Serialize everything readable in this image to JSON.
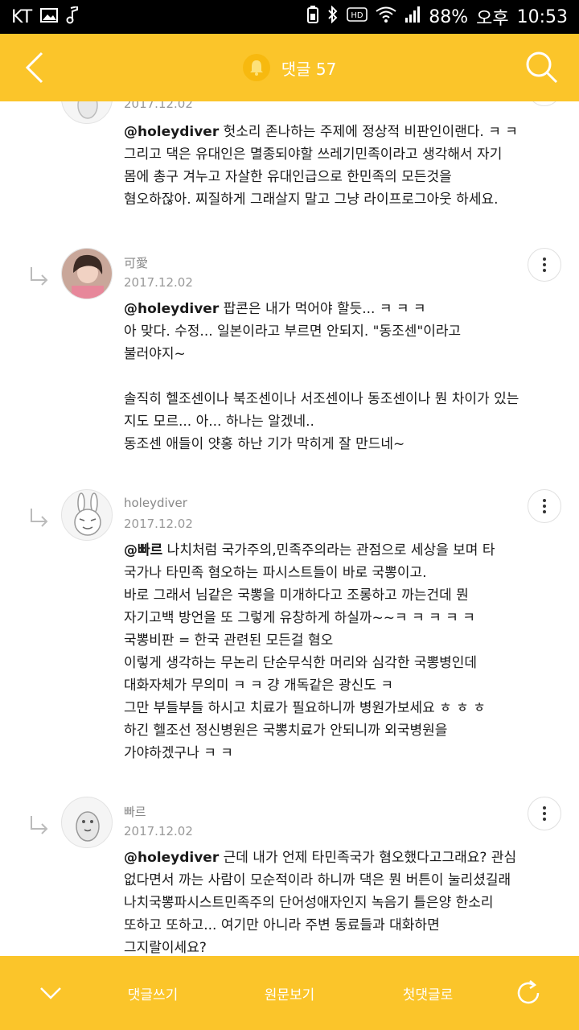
{
  "status_bar": {
    "carrier": "KT",
    "battery": "88%",
    "ampm": "오후",
    "time": "10:53"
  },
  "header": {
    "title": "댓글 57",
    "back_icon": "chevron-left-icon",
    "search_icon": "search-icon",
    "bell_icon": "bell-icon"
  },
  "comments": [
    {
      "date": "2017.12.02",
      "lines": [
        {
          "mention": "@holeydiver",
          "text": " 헛소리 존나하는 주제에 정상적 비판인이랜다. ㅋ ㅋ"
        },
        {
          "text": "그리고 댁은 유대인은 멸종되야할 쓰레기민족이라고 생각해서 자기"
        },
        {
          "text": "몸에 총구 겨누고 자살한 유대인급으로 한민족의 모든것을"
        },
        {
          "text": "혐오하잖아. 찌질하게 그래살지 말고 그냥 라이프로그아웃 하세요."
        }
      ]
    },
    {
      "author": "可愛",
      "date": "2017.12.02",
      "lines": [
        {
          "mention": "@holeydiver",
          "text": " 팝콘은 내가 먹어야 할듯... ㅋ ㅋ ㅋ"
        },
        {
          "text": "아 맞다. 수정... 일본이라고 부르면 안되지. \"동조센\"이라고"
        },
        {
          "text": "불러야지~"
        },
        {
          "text": ""
        },
        {
          "text": "솔직히 헬조센이나 북조센이나 서조센이나 동조센이나 뭔 차이가 있는"
        },
        {
          "text": "지도 모르... 아... 하나는 알겠네.."
        },
        {
          "text": "동조센 애들이 얏홍 하난 기가 막히게 잘 만드네~"
        }
      ]
    },
    {
      "author": "holeydiver",
      "date": "2017.12.02",
      "lines": [
        {
          "mention": "@빠르",
          "text": " 나치처럼 국가주의,민족주의라는 관점으로 세상을 보며 타"
        },
        {
          "text": "국가나 타민족 혐오하는 파시스트들이 바로 국뽕이고."
        },
        {
          "text": "바로 그래서 님같은 국뽕을 미개하다고 조롱하고 까는건데 뭔"
        },
        {
          "text": "자기고백 방언을 또 그렇게 유창하게 하실까~~ㅋ ㅋ ㅋ ㅋ ㅋ"
        },
        {
          "text": "국뽕비판 = 한국 관련된 모든걸 혐오"
        },
        {
          "text": "이렇게 생각하는 무논리 단순무식한 머리와 심각한 국뽕병인데"
        },
        {
          "text": "대화자체가 무의미 ㅋ ㅋ 걍 개독같은 광신도 ㅋ"
        },
        {
          "text": "그만 부들부들 하시고 치료가 필요하니까 병원가보세요 ㅎ ㅎ ㅎ"
        },
        {
          "text": "하긴 헬조선 정신병원은 국뽕치료가 안되니까 외국병원을"
        },
        {
          "text": "가야하겠구나 ㅋ ㅋ"
        }
      ]
    },
    {
      "author": "빠르",
      "date": "2017.12.02",
      "lines": [
        {
          "mention": "@holeydiver",
          "text": " 근데 내가 언제 타민족국가 혐오했다고그래요? 관심"
        },
        {
          "text": "없다면서 까는 사람이 모순적이라 하니까 댁은 뭔 버튼이 눌리셨길래"
        },
        {
          "text": "나치국뽕파시스트민족주의 단어성애자인지 녹음기 틀은양 한소리"
        },
        {
          "text": "또하고 또하고... 여기만 아니라 주변 동료들과 대화하면"
        },
        {
          "text": "그지랄이세요?"
        }
      ]
    }
  ],
  "bottom_bar": {
    "collapse_icon": "chevron-down-icon",
    "write_label": "댓글쓰기",
    "original_label": "원문보기",
    "first_label": "첫댓글로",
    "refresh_icon": "refresh-icon"
  },
  "colors": {
    "accent": "#fbc52a",
    "status_bar": "#000000"
  }
}
